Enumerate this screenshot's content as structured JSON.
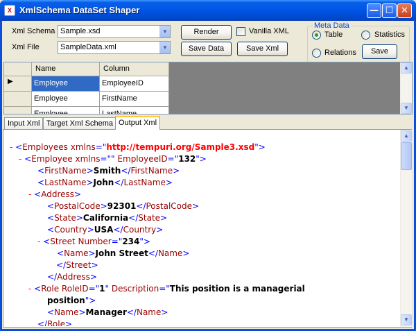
{
  "window": {
    "title": "XmlSchema DataSet Shaper",
    "minimize_glyph": "—",
    "maximize_glyph": "☐",
    "close_glyph": "✕"
  },
  "toolbar": {
    "schema_label": "Xml Schema",
    "schema_value": "Sample.xsd",
    "file_label": "Xml File",
    "file_value": "SampleData.xml",
    "render_label": "Render",
    "save_data_label": "Save Data",
    "vanilla_label": "Vanilla XML",
    "vanilla_checked": false,
    "save_xml_label": "Save Xml"
  },
  "meta_data": {
    "title": "Meta Data",
    "options": [
      {
        "label": "Table",
        "selected": true
      },
      {
        "label": "Statistics",
        "selected": false
      },
      {
        "label": "Relations",
        "selected": false
      }
    ],
    "save_label": "Save"
  },
  "grid": {
    "columns": [
      "Name",
      "Column"
    ],
    "rows": [
      {
        "name": "Employee",
        "column": "EmployeeID",
        "current": true
      },
      {
        "name": "Employee",
        "column": "FirstName",
        "current": false
      },
      {
        "name": "Employee",
        "column": "LastName",
        "current": false
      }
    ]
  },
  "tabs": [
    {
      "label": "Input Xml",
      "active": false
    },
    {
      "label": "Target Xml Schema",
      "active": false
    },
    {
      "label": "Output Xml",
      "active": true
    }
  ],
  "xml": {
    "minus": "-",
    "root_tag": "Employees",
    "xmlns_attr": "xmlns",
    "root_ns": "http://tempuri.org/Sample3.xsd",
    "employee_tag": "Employee",
    "employee_xmlns": "",
    "employee_id_attr": "EmployeeID",
    "employee_id": "132",
    "firstname_tag": "FirstName",
    "firstname": "Smith",
    "lastname_tag": "LastName",
    "lastname": "John",
    "address_tag": "Address",
    "postal_tag": "PostalCode",
    "postal": "92301",
    "state_tag": "State",
    "state": "California",
    "country_tag": "Country",
    "country": "USA",
    "street_tag": "Street",
    "street_number_attr": "Number",
    "street_number": "234",
    "name_tag": "Name",
    "street_name": "John Street",
    "role_tag": "Role",
    "role_id_attr": "RoleID",
    "role_id": "1",
    "role_desc_attr": "Description",
    "role_desc_1": "This position is a managerial",
    "role_desc_2": "position",
    "role_name": "Manager"
  }
}
